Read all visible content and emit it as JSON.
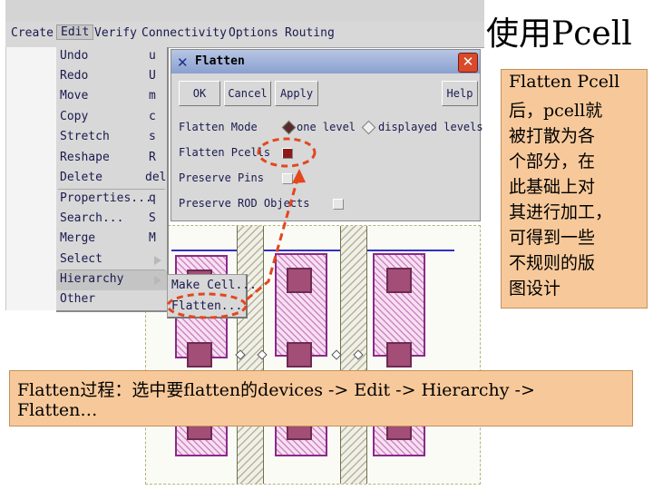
{
  "slide": {
    "title": "使用Pcell"
  },
  "menubar": {
    "items": [
      "Create",
      "Edit",
      "Verify",
      "Connectivity",
      "Options",
      "Routing"
    ]
  },
  "edit_menu": {
    "items": [
      {
        "label": "Undo",
        "key": "u"
      },
      {
        "label": "Redo",
        "key": "U"
      },
      {
        "label": "Move",
        "key": "m"
      },
      {
        "label": "Copy",
        "key": "c"
      },
      {
        "label": "Stretch",
        "key": "s"
      },
      {
        "label": "Reshape",
        "key": "R"
      },
      {
        "label": "Delete",
        "key": "del"
      },
      {
        "label": "Properties...",
        "key": "q"
      },
      {
        "label": "Search...",
        "key": "S"
      },
      {
        "label": "Merge",
        "key": "M"
      },
      {
        "label": "Select",
        "key": ""
      },
      {
        "label": "Hierarchy",
        "key": ""
      },
      {
        "label": "Other",
        "key": ""
      }
    ]
  },
  "hierarchy_submenu": {
    "items": [
      "Make Cell...",
      "Flatten..."
    ]
  },
  "flatten_dialog": {
    "title": "Flatten",
    "buttons": {
      "ok": "OK",
      "cancel": "Cancel",
      "apply": "Apply",
      "help": "Help"
    },
    "flatten_mode": {
      "label": "Flatten Mode",
      "options": [
        "one level",
        "displayed levels"
      ],
      "selected": "one level"
    },
    "flatten_pcells": {
      "label": "Flatten Pcells",
      "checked": true
    },
    "preserve_pins": {
      "label": "Preserve Pins",
      "checked": false
    },
    "preserve_rod_objects": {
      "label": "Preserve ROD Objects",
      "checked": false
    }
  },
  "right_note": {
    "lines": [
      "Flatten Pcell",
      "后，pcell就",
      "被打散为各",
      "个部分，在",
      "此基础上对",
      "其进行加工，",
      "可得到一些",
      "不规则的版",
      "图设计"
    ]
  },
  "caption": {
    "lines": [
      "Flatten过程：选中要flatten的devices -> Edit -> Hierarchy ->",
      "Flatten…"
    ]
  },
  "colors": {
    "note_bg": "#f7c99a",
    "highlight": "#e2471e",
    "dialog_title": "#8aa0cf",
    "layout_device": "#c060b0"
  }
}
